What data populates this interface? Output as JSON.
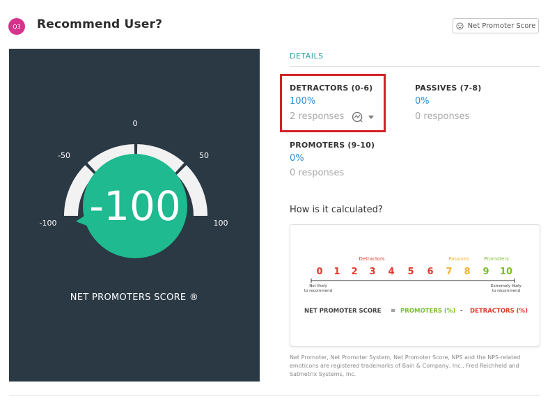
{
  "header": {
    "badge": "Q3",
    "title": "Recommend User?",
    "nps_button_label": "Net Promoter Score",
    "nps_button_icon": "smiley-icon"
  },
  "gauge": {
    "score": -100,
    "score_label": "-100",
    "ticks": [
      "-100",
      "-50",
      "0",
      "50",
      "100"
    ],
    "caption": "NET PROMOTERS SCORE ®",
    "colors": {
      "panel": "#2b3945",
      "accent": "#1fba8f",
      "track": "#f2f2f2"
    }
  },
  "details": {
    "heading": "DETAILS",
    "categories": [
      {
        "title": "DETRACTORS (0-6)",
        "percent": "100%",
        "responses": "2 responses"
      },
      {
        "title": "PASSIVES (7-8)",
        "percent": "0%",
        "responses": "0 responses"
      },
      {
        "title": "PROMOTERS (9-10)",
        "percent": "0%",
        "responses": "0 responses"
      }
    ],
    "toggle_icon": "chart-analysis-icon",
    "dropdown_icon": "caret-down-icon"
  },
  "calculation": {
    "heading": "How is it calculated?",
    "labels": {
      "detractors": "Detractors",
      "passives": "Passives",
      "promoters": "Promoters"
    },
    "scale": [
      "0",
      "1",
      "2",
      "3",
      "4",
      "5",
      "6",
      "7",
      "8",
      "9",
      "10"
    ],
    "not_likely": [
      "Not likely",
      "to recommend"
    ],
    "extremely_likely": [
      "Extremely likely",
      "to recommend"
    ],
    "formula": {
      "lhs": "NET PROMOTER SCORE",
      "eq": "=",
      "promoters": "PROMOTERS (%)",
      "minus": "-",
      "detractors": "DETRACTORS (%)"
    },
    "colors": {
      "detractors": "#e03a2f",
      "passives": "#f0b32d",
      "promoters": "#7bbf2a"
    }
  },
  "trademark": "Net Promoter, Net Promoter System, Net Promoter Score, NPS and the NPS-related emoticons are registered trademarks of Bain & Company, Inc., Fred Reichheld and Satmetrix Systems, Inc."
}
